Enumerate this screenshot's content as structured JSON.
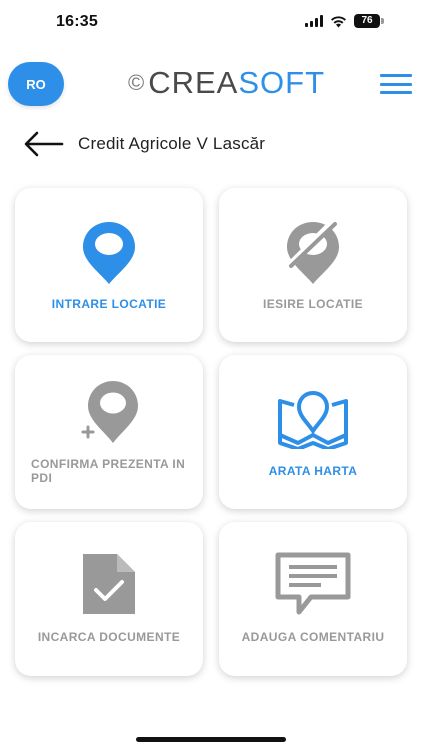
{
  "status_bar": {
    "time": "16:35",
    "battery_level": "76"
  },
  "header": {
    "language": "RO",
    "logo_symbol": "©",
    "logo_part1": "CREA",
    "logo_part2": "SOFT"
  },
  "title_bar": {
    "location_name": "Credit Agricole V Lascăr"
  },
  "actions": [
    {
      "label": "INTRARE LOCATIE",
      "icon": "location-pin-icon",
      "state": "active"
    },
    {
      "label": "IESIRE LOCATIE",
      "icon": "location-off-icon",
      "state": "disabled"
    },
    {
      "label": "CONFIRMA PREZENTA IN PDI",
      "icon": "location-add-icon",
      "state": "disabled"
    },
    {
      "label": "ARATA HARTA",
      "icon": "map-icon",
      "state": "active"
    },
    {
      "label": "INCARCA DOCUMENTE",
      "icon": "document-check-icon",
      "state": "disabled"
    },
    {
      "label": "ADAUGA COMENTARIU",
      "icon": "comment-icon",
      "state": "disabled"
    }
  ],
  "colors": {
    "accent": "#2e8fe8",
    "disabled": "#999999"
  }
}
